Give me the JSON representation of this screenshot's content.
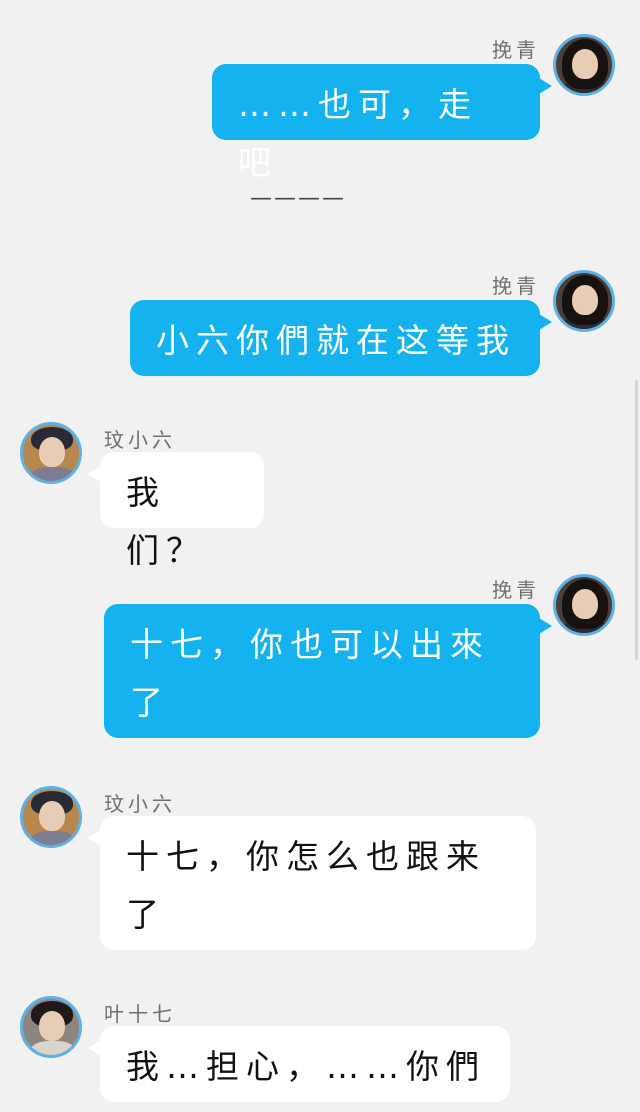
{
  "messages": [
    {
      "sender": "挽青",
      "text": "……也可，走吧",
      "side": "right"
    },
    {
      "separator": "————"
    },
    {
      "sender": "挽青",
      "text": "小六你們就在这等我",
      "side": "right"
    },
    {
      "sender": "玟小六",
      "text": "我们？",
      "side": "left"
    },
    {
      "sender": "挽青",
      "text": "十七，你也可以出來了",
      "side": "right"
    },
    {
      "sender": "玟小六",
      "text": "十七，你怎么也跟来了",
      "side": "left"
    },
    {
      "sender": "叶十七",
      "text": "我…担心，……你們",
      "side": "left"
    }
  ],
  "colors": {
    "background": "#f1f1f1",
    "outgoing_bubble": "#14b3ef",
    "incoming_bubble": "#ffffff",
    "avatar_ring": "#5fb0e6"
  }
}
